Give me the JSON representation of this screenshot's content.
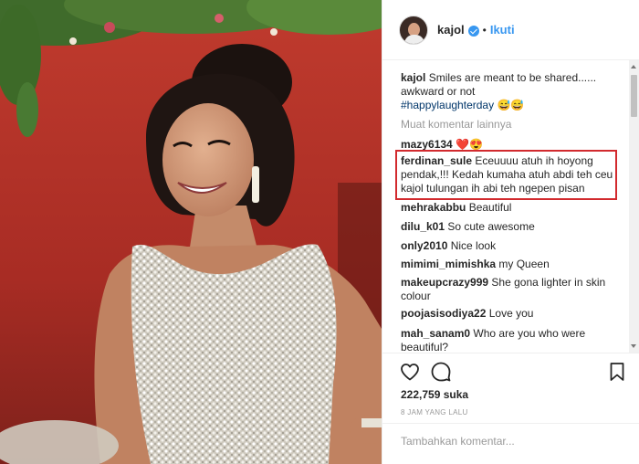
{
  "post": {
    "author": "kajol",
    "follow_label": "Ikuti",
    "separator": "•"
  },
  "caption": {
    "username": "kajol",
    "text": "Smiles are meant to be shared...... awkward or not",
    "hashtag": "#happylaughterday",
    "emoji": "😅😅"
  },
  "load_more_label": "Muat komentar lainnya",
  "comments": [
    {
      "username": "mazy6134",
      "text": "❤️😍"
    },
    {
      "username": "ferdinan_sule",
      "text": "Eceuuuu atuh ih hoyong pendak,!!! Kedah kumaha atuh abdi teh ceu kajol tulungan ih abi teh ngepen pisan"
    },
    {
      "username": "mehrakabbu",
      "text": "Beautiful"
    },
    {
      "username": "dilu_k01",
      "text": "So cute awesome"
    },
    {
      "username": "only2010",
      "text": "Nice look"
    },
    {
      "username": "mimimi_mimishka",
      "text": "my Queen"
    },
    {
      "username": "makeupcrazy999",
      "text": "She gona lighter in skin colour"
    },
    {
      "username": "poojasisodiya22",
      "text": "Love you"
    },
    {
      "username": "mah_sanam0",
      "text": "Who are you who were beautiful?"
    }
  ],
  "likes_count": "222,759",
  "likes_word": "suka",
  "time_ago": "8 JAM YANG LALU",
  "add_comment_placeholder": "Tambahkan komentar...",
  "colors": {
    "link_blue": "#3897f0",
    "highlight_red": "#d22a2e",
    "wall_red": "#a92e25",
    "muted_gray": "#999999"
  },
  "icons": {
    "avatar": "profile-photo",
    "verified": "verified-badge-icon",
    "like": "heart-outline-icon",
    "comment": "speech-bubble-icon",
    "save": "bookmark-icon"
  }
}
